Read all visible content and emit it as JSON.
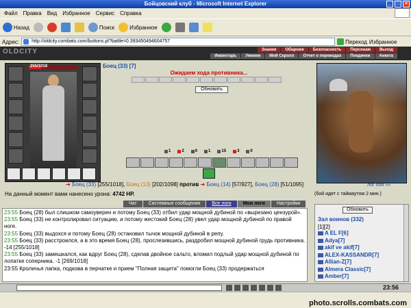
{
  "window": {
    "title": "Бойцовский клуб - Microsoft Internet Explorer"
  },
  "menu": [
    "Файл",
    "Правка",
    "Вид",
    "Избранное",
    "Сервис",
    "Справка"
  ],
  "toolbar": {
    "back": "Назад",
    "search": "Поиск",
    "favorites": "Избранное"
  },
  "address": {
    "label": "Адрес:",
    "url": "http://oldcity.combats.com/buttons.pl?battle=0.393450494604757",
    "go": "Переход",
    "links": "Избранное"
  },
  "site": {
    "logo": "OLDCITY",
    "nav_top": [
      "Знания",
      "Общение",
      "Безопасность",
      "Персонаж",
      "Выход"
    ],
    "nav_bottom": [
      "Инвентарь",
      "Умения",
      "Мой Скролл",
      "Отчет о переводах",
      "Поединки",
      "Анкета"
    ]
  },
  "player": {
    "hp_text": "255/1018",
    "hp_fraction": 0.25,
    "name_line": "Боец (33) [7]"
  },
  "battle": {
    "waiting": "Ожидаем хода противника...",
    "refresh": "Обновить",
    "stats": [
      "1",
      "2",
      "0",
      "1",
      "15",
      "3",
      "0"
    ],
    "line": {
      "p1": "Боец (33)",
      "p1_hp": "[255/1018],",
      "p2": "Боец (13)",
      "p2_hp": "[202/1098]",
      "vs": "против",
      "p3": "Боец (14)",
      "p3_hp": "[57/927],",
      "p4": "Боец (28)",
      "p4_hp": "[51/1095]"
    },
    "log_link": "лог боя »»",
    "damage_label": "На данный момент вами нанесено урона:",
    "damage_value": "4742 HP.",
    "timeout": "(бой идет с таймаутом 2 мин.)"
  },
  "tabs": [
    "Чат",
    "Системные сообщения",
    "Все логи",
    "Мои логи",
    "Настройки"
  ],
  "chat": [
    {
      "time": "23:55",
      "text": "Боец (28) был слишком самоуверен и потому Боец (33) отбил удар мощной дубиной по «вырезано цензурой»."
    },
    {
      "time": "23:55",
      "text": "Боец (33) не контролировал ситуацию, и потому жестокий Боец (28) увел удар мощной дубиной по правой ноге."
    },
    {
      "time": "23:55",
      "text": "Боец (33) выдохся и потому Боец (28) остановил тычок мощной дубиной в репу."
    },
    {
      "time": "23:55",
      "text": "Боец (33) расстроился, а в это время Боец (28), прослезившись, раздробил мощной дубиной грудь противника. -14 [255/1018]"
    },
    {
      "time": "23:55",
      "text": "Боец (33) замешкался, как вдруг Боец (28), сделав двойное сальто, вломил подлый удар мощной дубиной по лопатке соперника. -1 [269/1018]"
    },
    {
      "time": "23:55",
      "text": "Кроличья лапка, подкова в перчатке и прием \"Полная защита\" помогли Боец (33) продержаться"
    }
  ],
  "side": {
    "refresh": "Обновить",
    "hall": "Зал воинов (332)",
    "pages": "[1][2]",
    "players": [
      "A EL F[6]",
      "Adya[7]",
      "akif ve akif[7]",
      "ALEX-KASSANDR[7]",
      "Allian-Z[7]",
      "Almera Classic[7]",
      "Amber[7]"
    ]
  },
  "clock": "23:56",
  "watermark": "photo.scrolls.combats.com",
  "colors": {
    "accent_blue": "#1a4ba8",
    "alert_red": "#cc0000",
    "time_green": "#1a8a1a"
  }
}
